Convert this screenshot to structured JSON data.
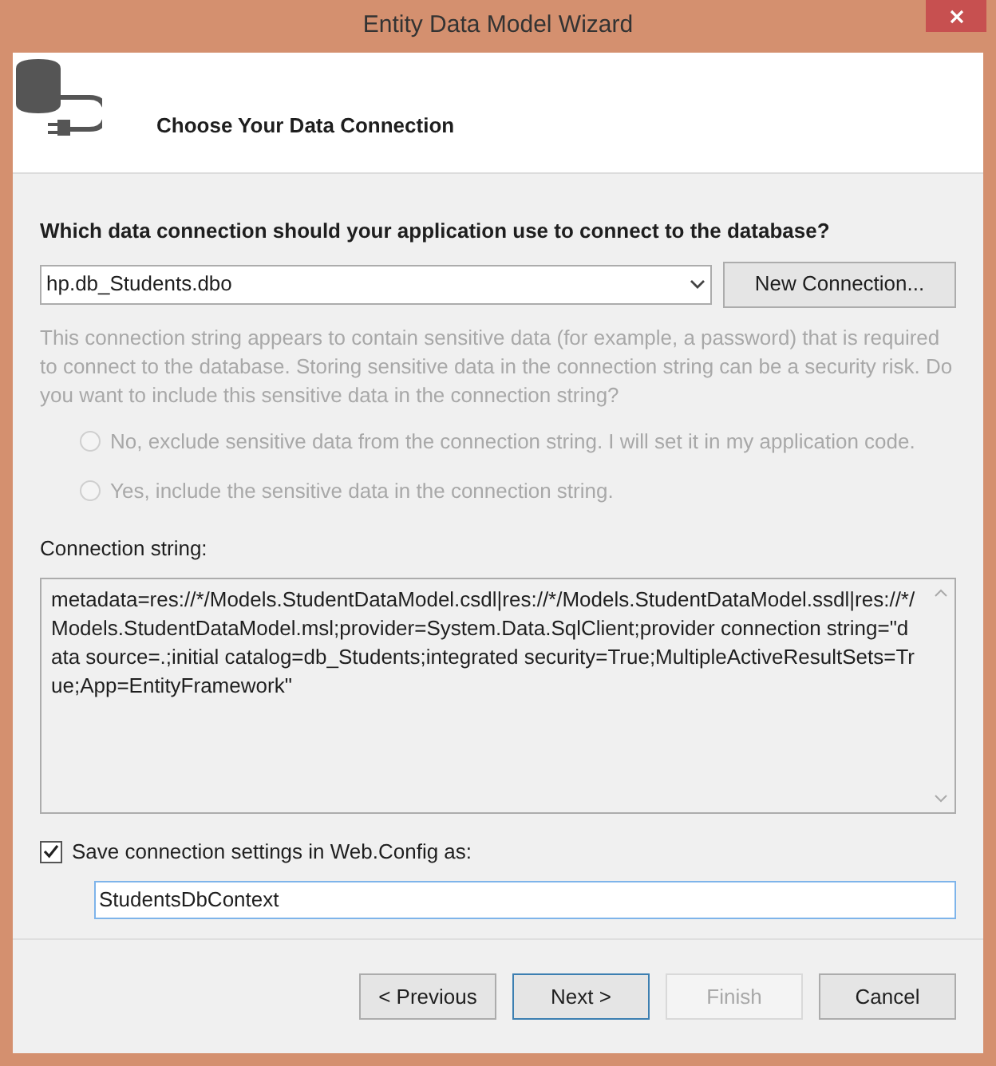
{
  "window": {
    "title": "Entity Data Model Wizard"
  },
  "header": {
    "title": "Choose Your Data Connection"
  },
  "question": "Which data connection should your application use to connect to the database?",
  "connection_select": {
    "value": "hp.db_Students.dbo"
  },
  "new_connection_button": {
    "label": "New Connection...",
    "disabled": false
  },
  "sensitive_note": {
    "text": "This connection string appears to contain sensitive data (for example, a password) that is required to connect to the database. Storing sensitive data in the connection string can be a security risk. Do you want to include this sensitive data in the connection string?",
    "disabled": true
  },
  "sensitive_options": [
    {
      "label": "No, exclude sensitive data from the connection string. I will set it in my application code.",
      "selected": false,
      "disabled": true
    },
    {
      "label": "Yes, include the sensitive data in the connection string.",
      "selected": false,
      "disabled": true
    }
  ],
  "connection_string": {
    "label": "Connection string:",
    "value": "metadata=res://*/Models.StudentDataModel.csdl|res://*/Models.StudentDataModel.ssdl|res://*/Models.StudentDataModel.msl;provider=System.Data.SqlClient;provider connection string=\"data source=.;initial catalog=db_Students;integrated security=True;MultipleActiveResultSets=True;App=EntityFramework\""
  },
  "save_setting": {
    "label": "Save connection settings in Web.Config as:",
    "checked": true,
    "value": "StudentsDbContext"
  },
  "buttons": [
    {
      "label": "< Previous",
      "disabled": false,
      "default": false
    },
    {
      "label": "Next >",
      "disabled": false,
      "default": true
    },
    {
      "label": "Finish",
      "disabled": true,
      "default": false
    },
    {
      "label": "Cancel",
      "disabled": false,
      "default": false
    }
  ]
}
